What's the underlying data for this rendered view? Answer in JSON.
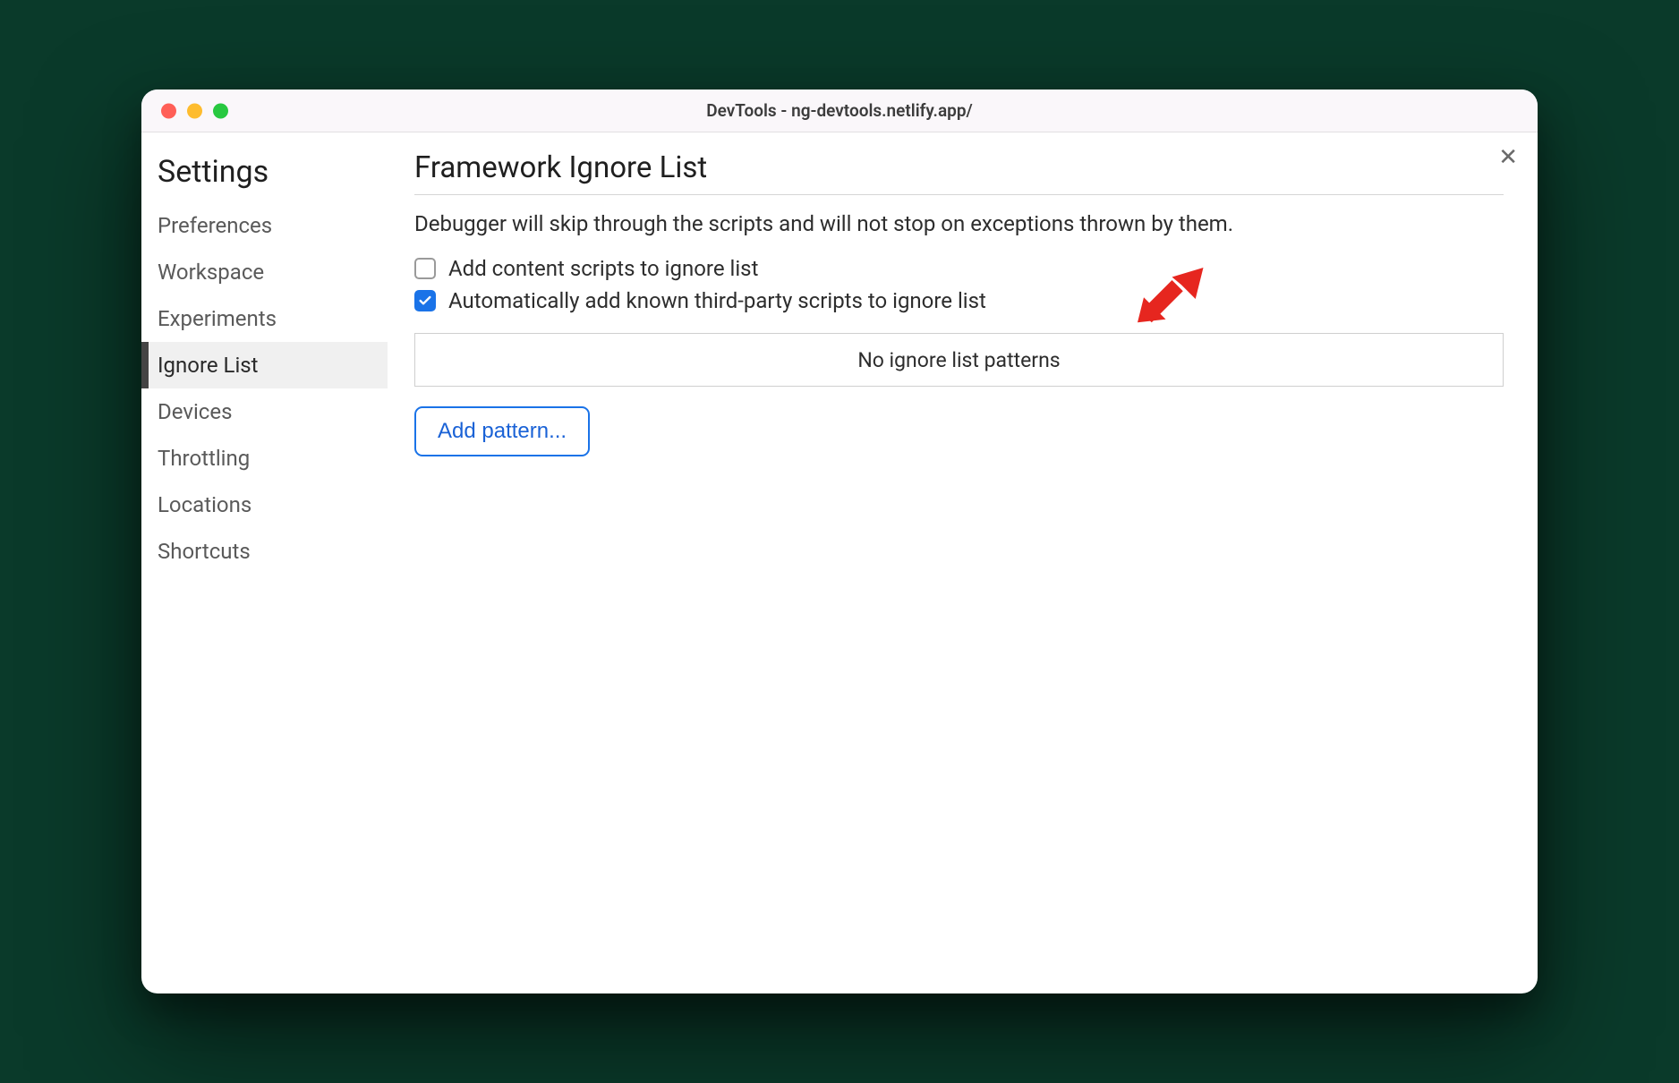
{
  "window": {
    "title": "DevTools - ng-devtools.netlify.app/",
    "close_glyph": "✕"
  },
  "sidebar": {
    "title": "Settings",
    "items": [
      {
        "label": "Preferences",
        "active": false
      },
      {
        "label": "Workspace",
        "active": false
      },
      {
        "label": "Experiments",
        "active": false
      },
      {
        "label": "Ignore List",
        "active": true
      },
      {
        "label": "Devices",
        "active": false
      },
      {
        "label": "Throttling",
        "active": false
      },
      {
        "label": "Locations",
        "active": false
      },
      {
        "label": "Shortcuts",
        "active": false
      }
    ]
  },
  "main": {
    "heading": "Framework Ignore List",
    "description": "Debugger will skip through the scripts and will not stop on exceptions thrown by them.",
    "checkboxes": [
      {
        "label": "Add content scripts to ignore list",
        "checked": false
      },
      {
        "label": "Automatically add known third-party scripts to ignore list",
        "checked": true
      }
    ],
    "patterns_empty_text": "No ignore list patterns",
    "add_pattern_label": "Add pattern...",
    "annotation": {
      "arrow_color": "#e6261f"
    }
  }
}
